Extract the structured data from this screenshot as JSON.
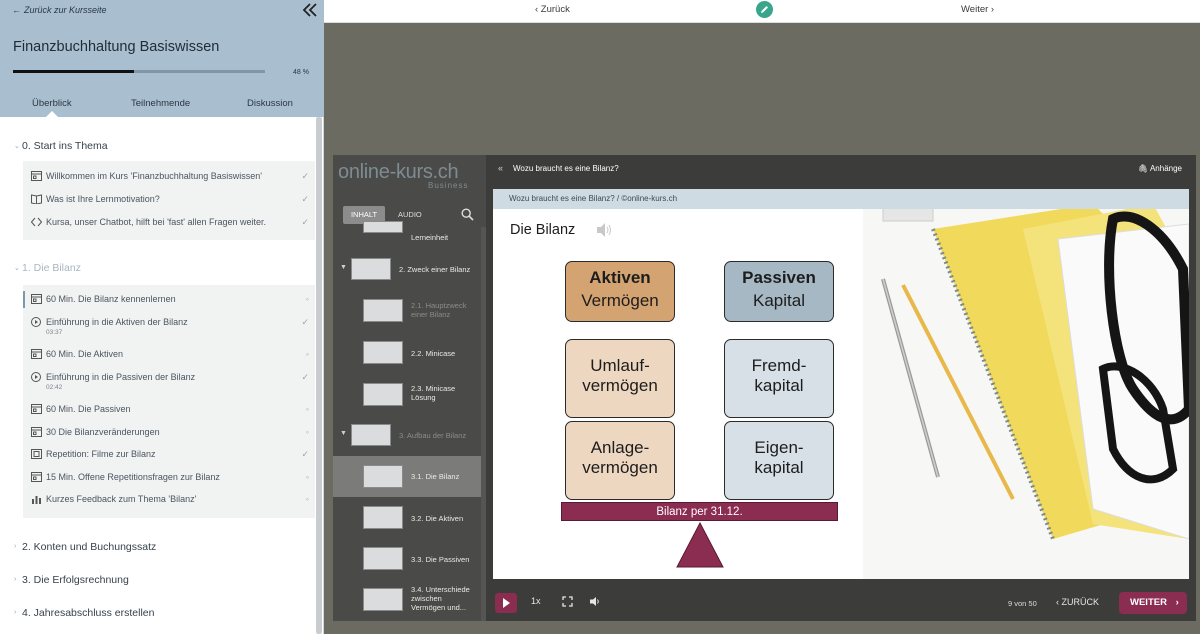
{
  "sidebar": {
    "back_link": "Zurück zur Kursseite",
    "course_title": "Finanzbuchhaltung Basiswissen",
    "progress_percent": 48,
    "progress_label": "48 %",
    "tabs": [
      "Überblick",
      "Teilnehmende",
      "Diskussion"
    ],
    "chapters": [
      {
        "label": "0. Start ins Thema"
      },
      {
        "label": "1. Die Bilanz"
      },
      {
        "label": "2. Konten und Buchungssatz"
      },
      {
        "label": "3. Die Erfolgsrechnung"
      },
      {
        "label": "4. Jahresabschluss erstellen"
      }
    ],
    "items0": [
      {
        "label": "Willkommen im Kurs 'Finanzbuchhaltung Basiswissen'",
        "icon": "slides-icon",
        "done": "✓"
      },
      {
        "label": "Was ist Ihre Lernmotivation?",
        "icon": "book-icon",
        "done": "✓"
      },
      {
        "label": "Kursa, unser Chatbot, hilft bei 'fast' allen Fragen weiter.",
        "icon": "code-icon",
        "done": "✓"
      }
    ],
    "items1": [
      {
        "label": "60 Min. Die Bilanz kennenlernen",
        "icon": "slides-icon",
        "sub": "",
        "done": "◦"
      },
      {
        "label": "Einführung in die Aktiven der Bilanz",
        "icon": "play-icon",
        "sub": "03:37",
        "done": "✓"
      },
      {
        "label": "60 Min. Die Aktiven",
        "icon": "slides-icon",
        "sub": "",
        "done": "◦"
      },
      {
        "label": "Einführung in die Passiven der Bilanz",
        "icon": "play-icon",
        "sub": "02:42",
        "done": "✓"
      },
      {
        "label": "60 Min. Die Passiven",
        "icon": "slides-icon",
        "sub": "",
        "done": "◦"
      },
      {
        "label": "30 Die Bilanzveränderungen",
        "icon": "slides-icon",
        "sub": "",
        "done": "◦"
      },
      {
        "label": "Repetition: Filme zur Bilanz",
        "icon": "film-icon",
        "sub": "",
        "done": "✓"
      },
      {
        "label": "15 Min. Offene Repetitionsfragen zur Bilanz",
        "icon": "slides-icon",
        "sub": "",
        "done": "◦"
      },
      {
        "label": "Kurzes Feedback zum Thema 'Bilanz'",
        "icon": "chart-icon",
        "sub": "",
        "done": "◦"
      }
    ]
  },
  "topnav": {
    "back": "‹ Zurück",
    "next": "Weiter ›"
  },
  "player": {
    "logo": "online-kurs.ch",
    "logo_sub": "Business",
    "tab_inhalt": "INHALT",
    "tab_audio": "AUDIO",
    "outline": [
      {
        "label": "Lerneinheit"
      },
      {
        "label": "2. Zweck einer Bilanz"
      },
      {
        "label": "2.1. Hauptzweck einer Bilanz"
      },
      {
        "label": "2.2. Minicase"
      },
      {
        "label": "2.3. Minicase Lösung"
      },
      {
        "label": "3. Aufbau der Bilanz"
      },
      {
        "label": "3.1. Die Bilanz"
      },
      {
        "label": "3.2. Die Aktiven"
      },
      {
        "label": "3.3. Die Passiven"
      },
      {
        "label": "3.4. Unterschiede zwischen Vermögen und..."
      }
    ],
    "title": "Wozu braucht es eine Bilanz?",
    "attachments": "Anhänge",
    "slide": {
      "header": "Wozu braucht es eine Bilanz? / ©online-kurs.ch",
      "title": "Die Bilanz",
      "aktiven": "Aktiven",
      "vermoegen": "Vermögen",
      "passiven": "Passiven",
      "kapital": "Kapital",
      "umlauf1": "Umlauf-",
      "umlauf2": "vermögen",
      "fremd1": "Fremd-",
      "fremd2": "kapital",
      "anlage1": "Anlage-",
      "anlage2": "vermögen",
      "eigen1": "Eigen-",
      "eigen2": "kapital",
      "base": "Bilanz per 31.12."
    },
    "speed": "1x",
    "page": "9 von 50",
    "zurueck": "ZURÜCK",
    "weiter": "WEITER"
  },
  "colors": {
    "accent": "#8b2c51",
    "header_blue": "#a9bfd0",
    "edit_green": "#3aa58d"
  }
}
